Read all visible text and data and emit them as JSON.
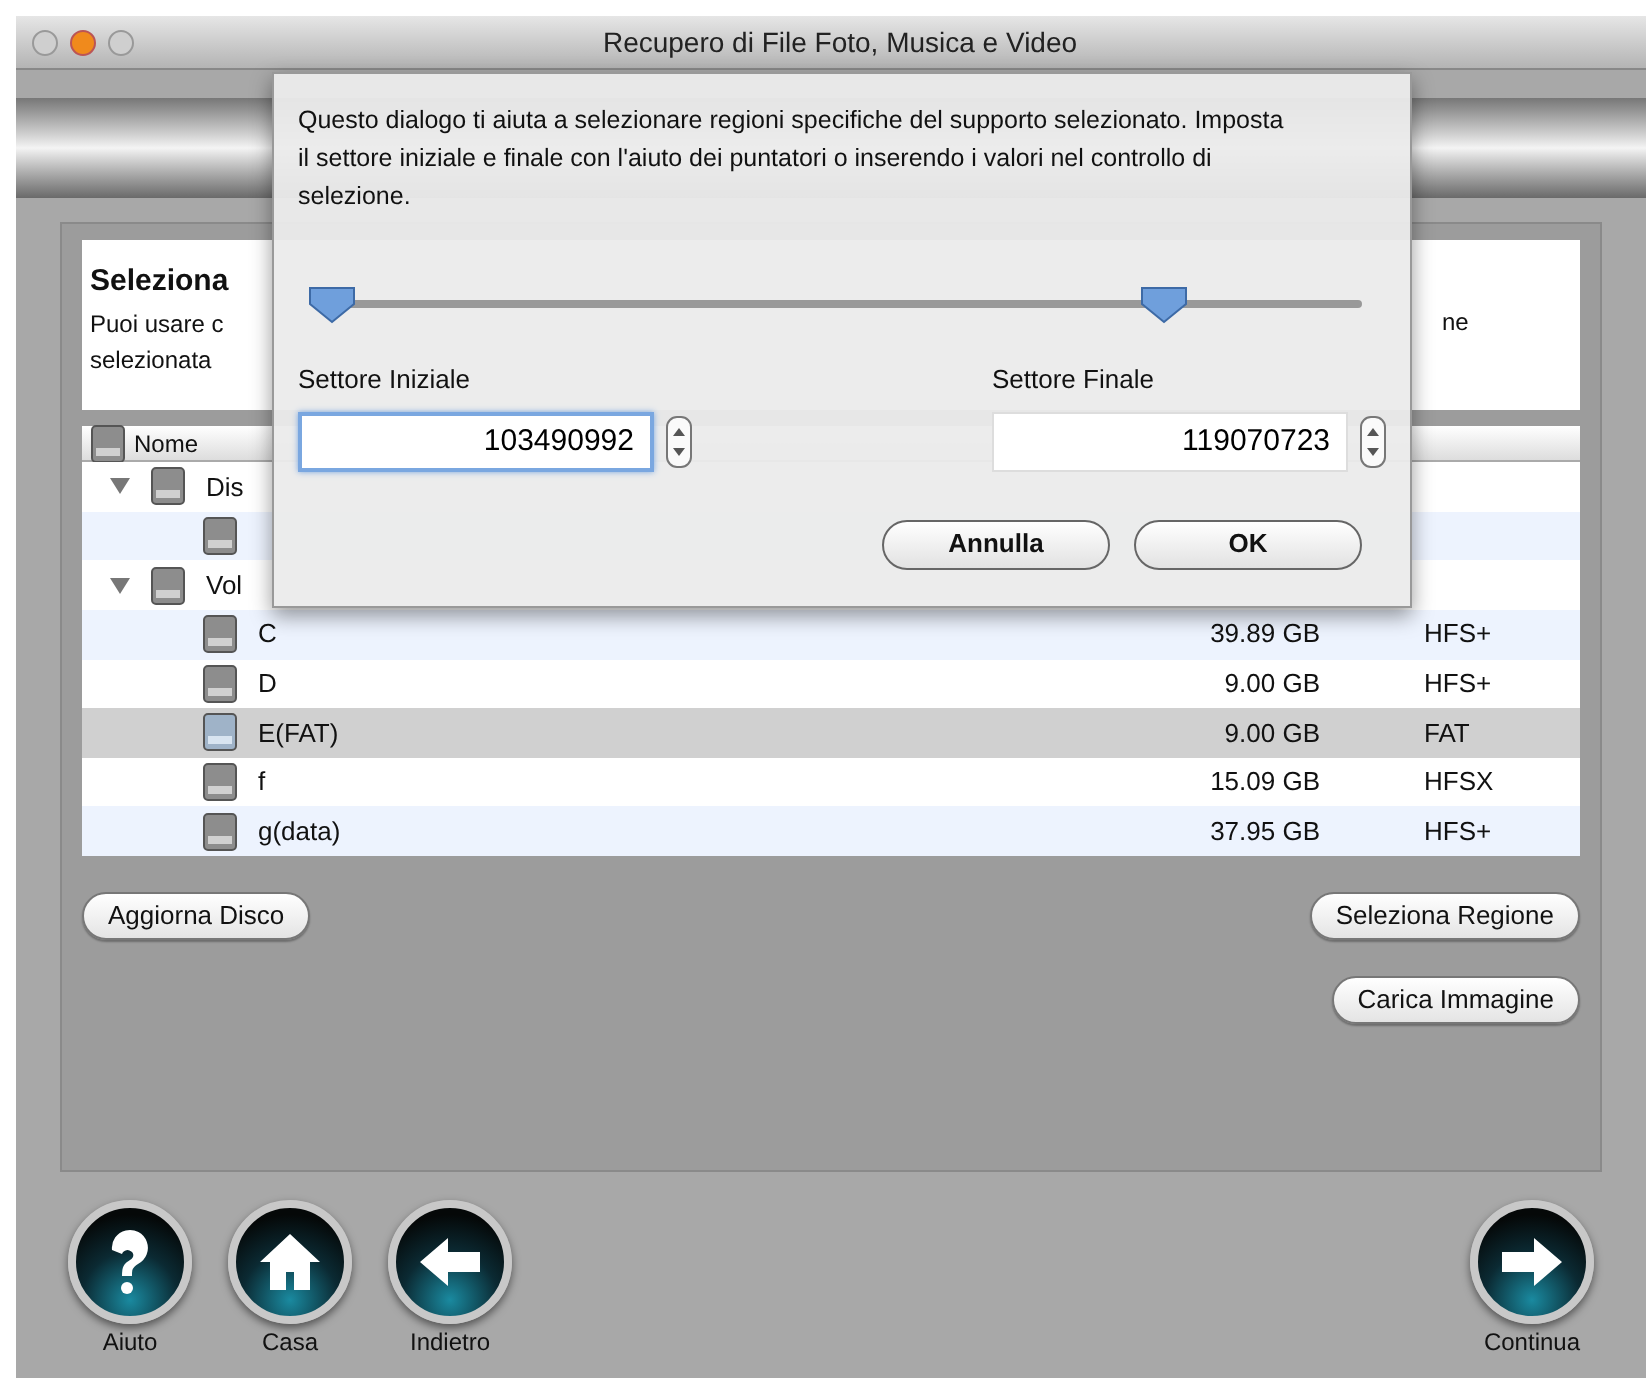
{
  "window": {
    "title": "Recupero di File Foto, Musica e Video"
  },
  "panel": {
    "heading": "Seleziona",
    "lines": [
      "Puoi usare c",
      "selezionata"
    ],
    "line_end": "ne"
  },
  "table": {
    "columns": [
      "Nome"
    ],
    "rows": [
      {
        "name": "Dis",
        "expanded": true,
        "selected": false,
        "children": [
          {
            "selected": false
          }
        ]
      },
      {
        "name": "Vol",
        "expanded": true,
        "selected": false,
        "children": [
          {
            "name": "C",
            "size": "39.89 GB",
            "format": "HFS+",
            "selected": false
          },
          {
            "name": "D",
            "size": "9.00 GB",
            "format": "HFS+",
            "selected": false
          },
          {
            "name": "E(FAT)",
            "size": "9.00 GB",
            "format": "FAT",
            "selected": true
          },
          {
            "name": "f",
            "size": "15.09 GB",
            "format": "HFSX",
            "selected": false
          },
          {
            "name": "g(data)",
            "size": "37.95 GB",
            "format": "HFS+",
            "selected": false
          }
        ]
      }
    ]
  },
  "buttons_left": [
    "Aggiorna Disco"
  ],
  "buttons_right": [
    "Seleziona Regione",
    "Carica Immagine"
  ],
  "nav": [
    {
      "kind": "help",
      "label": "Aiuto"
    },
    {
      "kind": "home",
      "label": "Casa"
    },
    {
      "kind": "back",
      "label": "Indietro"
    },
    {
      "kind": "next",
      "label": "Continua"
    }
  ],
  "dialog": {
    "message": "Questo dialogo ti aiuta a selezionare regioni specifiche del supporto selezionato. Imposta il settore iniziale e finale con l'aiuto dei puntatori o inserendo i valori nel controllo di selezione.",
    "slider": {
      "thumbs": [
        {
          "level": 0.01
        },
        {
          "level": 0.81
        }
      ]
    },
    "start": {
      "label": "Settore Iniziale",
      "value": "103490992",
      "focused": true
    },
    "end": {
      "label": "Settore Finale",
      "value": "119070723",
      "focused": false
    },
    "buttons": [
      "Annulla",
      "OK"
    ]
  }
}
